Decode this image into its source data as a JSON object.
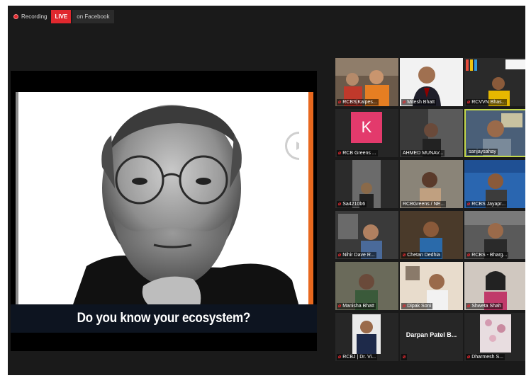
{
  "meeting": {
    "recording_label": "Recording",
    "live_label": "LIVE",
    "live_destination": "on Facebook"
  },
  "shared_slide": {
    "caption": "Do you know your ecosystem?"
  },
  "participants": [
    {
      "name": "RCBS|Kalpes...",
      "muted": true
    },
    {
      "name": "Mitesh Bhatt",
      "muted": true
    },
    {
      "name": "RCVVN Bhas...",
      "muted": true
    },
    {
      "name": "RCB Greens ...",
      "muted": true,
      "avatar_letter": "K"
    },
    {
      "name": "AHMED MUNAV...",
      "muted": false
    },
    {
      "name": "sanjaysahay",
      "muted": false,
      "active_speaker": true
    },
    {
      "name": "Sa4210b6",
      "muted": true
    },
    {
      "name": "RCBGreens / NE...",
      "muted": false
    },
    {
      "name": "RCBS Jayapr...",
      "muted": true
    },
    {
      "name": "Nihir Dave R...",
      "muted": true
    },
    {
      "name": "Chetan Dedhia",
      "muted": true
    },
    {
      "name": "RCBS - Bharg...",
      "muted": true
    },
    {
      "name": "Manisha Bhatt",
      "muted": true
    },
    {
      "name": "Dipak Soni",
      "muted": true
    },
    {
      "name": "Shweta Shah",
      "muted": true
    },
    {
      "name": "RCBJ | Dr. Vi...",
      "muted": true
    },
    {
      "name": "Darpan Patel B...",
      "muted": true,
      "video_off": true
    },
    {
      "name": "Dharmesh S...",
      "muted": true
    }
  ],
  "colors": {
    "live_red": "#e0282e",
    "active_speaker_border": "#c5d84a",
    "slide_accent": "#e8681e"
  }
}
